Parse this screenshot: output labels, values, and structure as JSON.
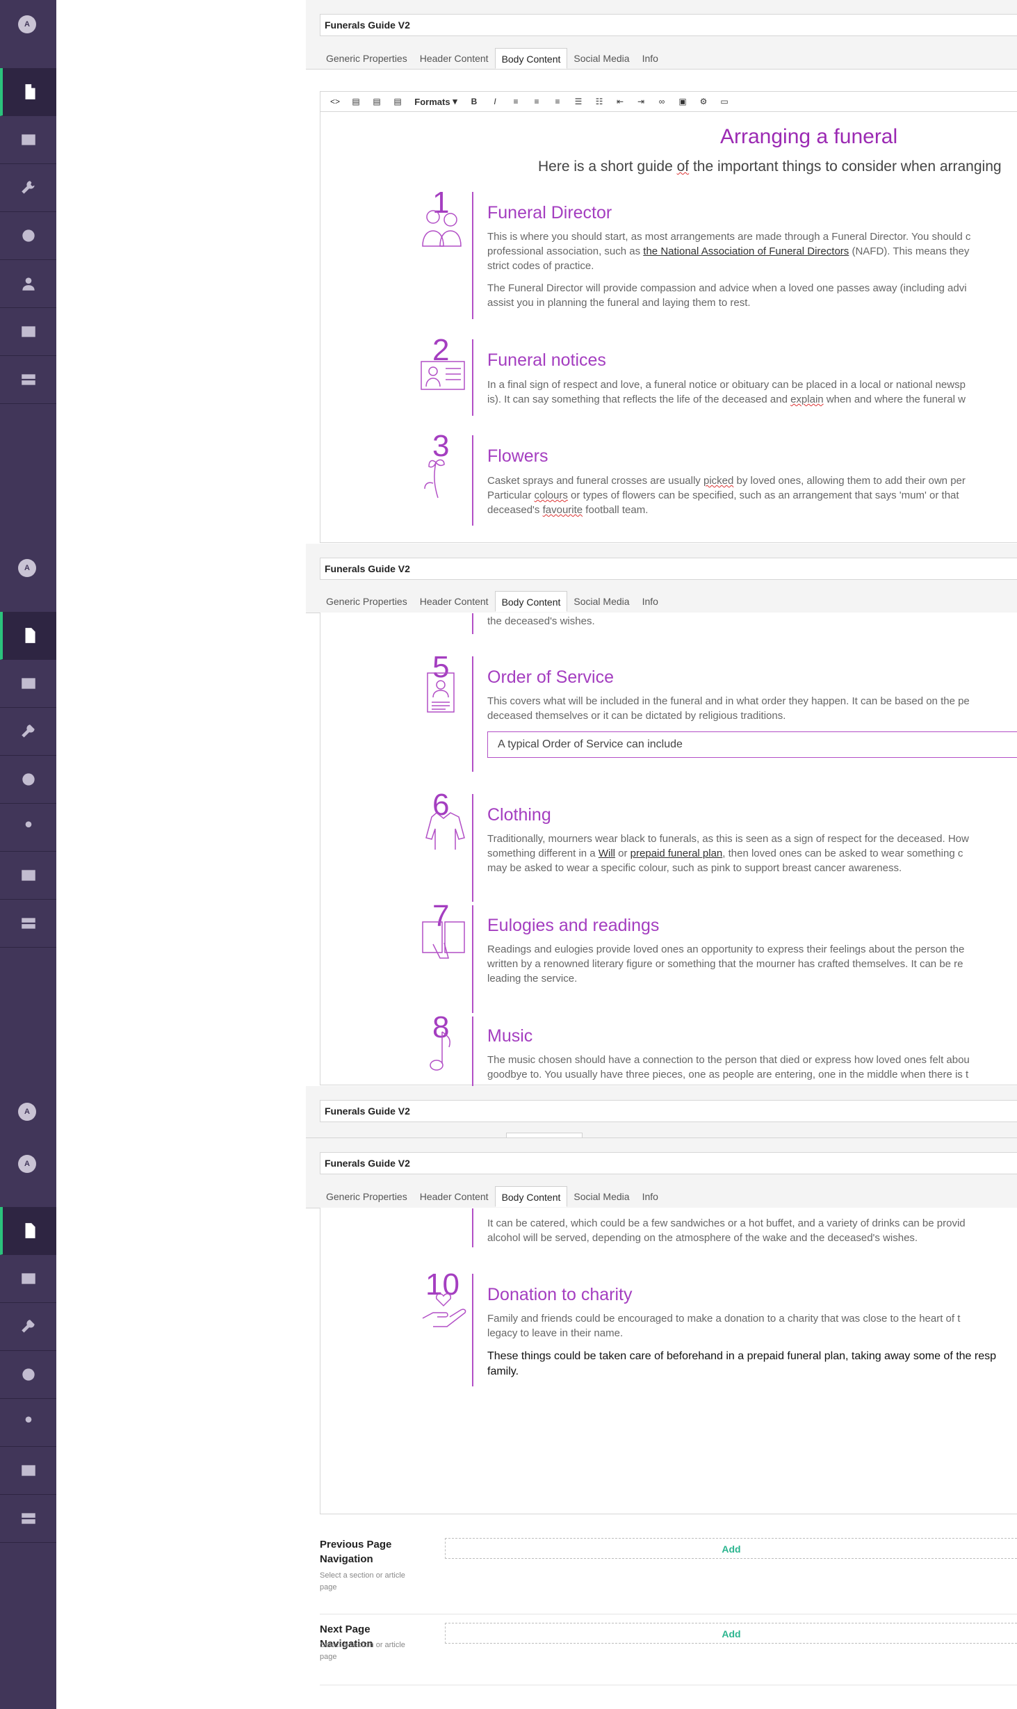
{
  "sidebar": {
    "avatar_initial": "A",
    "items": [
      "content-icon",
      "media-icon",
      "settings-wrench-icon",
      "gear-icon",
      "user-icon",
      "member-card-icon",
      "forms-icon"
    ]
  },
  "document": {
    "name": "Funerals Guide V2",
    "tabs": [
      "Generic Properties",
      "Header Content",
      "Body Content",
      "Social Media",
      "Info"
    ],
    "active_tab": "Body Content"
  },
  "toolbar": {
    "formats_label": "Formats",
    "buttons": [
      "source-code-icon",
      "template-icon",
      "template-icon",
      "template-icon",
      "formats-dropdown",
      "bold-icon",
      "italic-icon",
      "align-left-icon",
      "align-center-icon",
      "align-right-icon",
      "bullet-list-icon",
      "numbered-list-icon",
      "outdent-icon",
      "indent-icon",
      "link-icon",
      "image-icon",
      "macro-icon",
      "embed-icon"
    ]
  },
  "article": {
    "title": "Arranging a funeral",
    "intro_before": "Here is a short guide ",
    "intro_spell": "of",
    "intro_after": " the important things to consider when arranging",
    "steps": {
      "s1": {
        "num": "1",
        "title": "Funeral Director",
        "p1_a": "This is where you should start, as most arrangements are made through a Funeral Director. You should c",
        "p1_b": "professional association, such as ",
        "p1_link": "the National Association of Funeral Directors",
        "p1_c": " (NAFD). This means they",
        "p1_d": "strict codes of practice.",
        "p2_a": "The Funeral Director will provide compassion and advice when a loved one passes away (including advi",
        "p2_b": "assist you in planning the funeral and laying them to rest."
      },
      "s2": {
        "num": "2",
        "title": "Funeral notices",
        "l1": "In a final sign of respect and love, a funeral notice or obituary can be placed in a local or national newsp",
        "l2_a": "is). It can say something that reflects the life of the deceased and ",
        "l2_spell": "explain",
        "l2_b": " when and where the funeral w"
      },
      "s3": {
        "num": "3",
        "title": "Flowers",
        "l1_a": "Casket sprays and funeral crosses are usually ",
        "l1_spell": "picked",
        "l1_b": " by loved ones, allowing them to add their own per",
        "l2_a": "Particular ",
        "l2_spell": "colours",
        "l2_b": " or types of flowers can be specified, such as an arrangement that says 'mum' or that",
        "l3_a": "deceased's ",
        "l3_spell": "favourite",
        "l3_b": " football team."
      },
      "s4_tail": "the deceased's wishes.",
      "s5": {
        "num": "5",
        "title": "Order of Service",
        "l1": "This covers what will be included in the funeral and in what order they happen. It can be based on the pe",
        "l2": "deceased themselves or it can be dictated by religious traditions.",
        "callout": "A typical Order of Service can include"
      },
      "s6": {
        "num": "6",
        "title": "Clothing",
        "l1": "Traditionally, mourners wear black to funerals, as this is seen as a sign of respect for the deceased. How",
        "l2_a": "something different in a ",
        "l2_link1": "Will",
        "l2_b": " or ",
        "l2_link2": "prepaid funeral plan",
        "l2_c": ", then loved ones can be asked to wear something c",
        "l3": "may be asked to wear a specific colour, such as pink to support breast cancer awareness."
      },
      "s7": {
        "num": "7",
        "title": "Eulogies and readings",
        "l1": "Readings and eulogies provide loved ones an opportunity to express their feelings about the person the",
        "l2": "written by a renowned literary figure or something that the mourner has crafted themselves. It can be re",
        "l3": "leading the service."
      },
      "s8": {
        "num": "8",
        "title": "Music",
        "l1": "The music chosen should have a connection to the person that died or express how loved ones felt abou",
        "l2": "goodbye to. You usually have three pieces, one as people are entering, one in the middle when there is t"
      },
      "s9_tail_1": "It can be catered, which could be a few sandwiches or a hot buffet, and a variety of drinks can be provid",
      "s9_tail_2": "alcohol will be served, depending on the atmosphere of the wake and the deceased's wishes.",
      "s10": {
        "num": "10",
        "title": "Donation to charity",
        "l1": "Family and friends could be encouraged to make a donation to a charity that was close to the heart of t",
        "l2": "legacy to leave in their name.",
        "l3": "These things could be taken care of beforehand in a prepaid funeral plan, taking away some of the resp",
        "l4": "family."
      }
    }
  },
  "navigation": {
    "previous": {
      "label": "Previous Page Navigation",
      "hint": "Select a section or article page",
      "add": "Add"
    },
    "next": {
      "label": "Next Page Navigation",
      "hint": "Select a section or article page",
      "add": "Add"
    }
  },
  "colors": {
    "sidebar": "#413659",
    "accent": "#a43ec0",
    "active_marker": "#2bc37c",
    "add_text": "#2bb58f"
  }
}
